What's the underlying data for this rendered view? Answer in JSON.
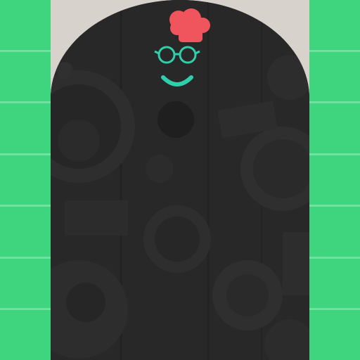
{
  "app": {
    "screen": "splash",
    "logo_icon": "chef-face-logo-icon",
    "colors": {
      "accent_green": "#3ed57e",
      "hat_red": "#f0545c",
      "face_teal": "#2fcfab",
      "background_dark": "#2a2a2a"
    }
  },
  "side_panels": {
    "left_tiles": 7,
    "right_tiles": 7
  }
}
